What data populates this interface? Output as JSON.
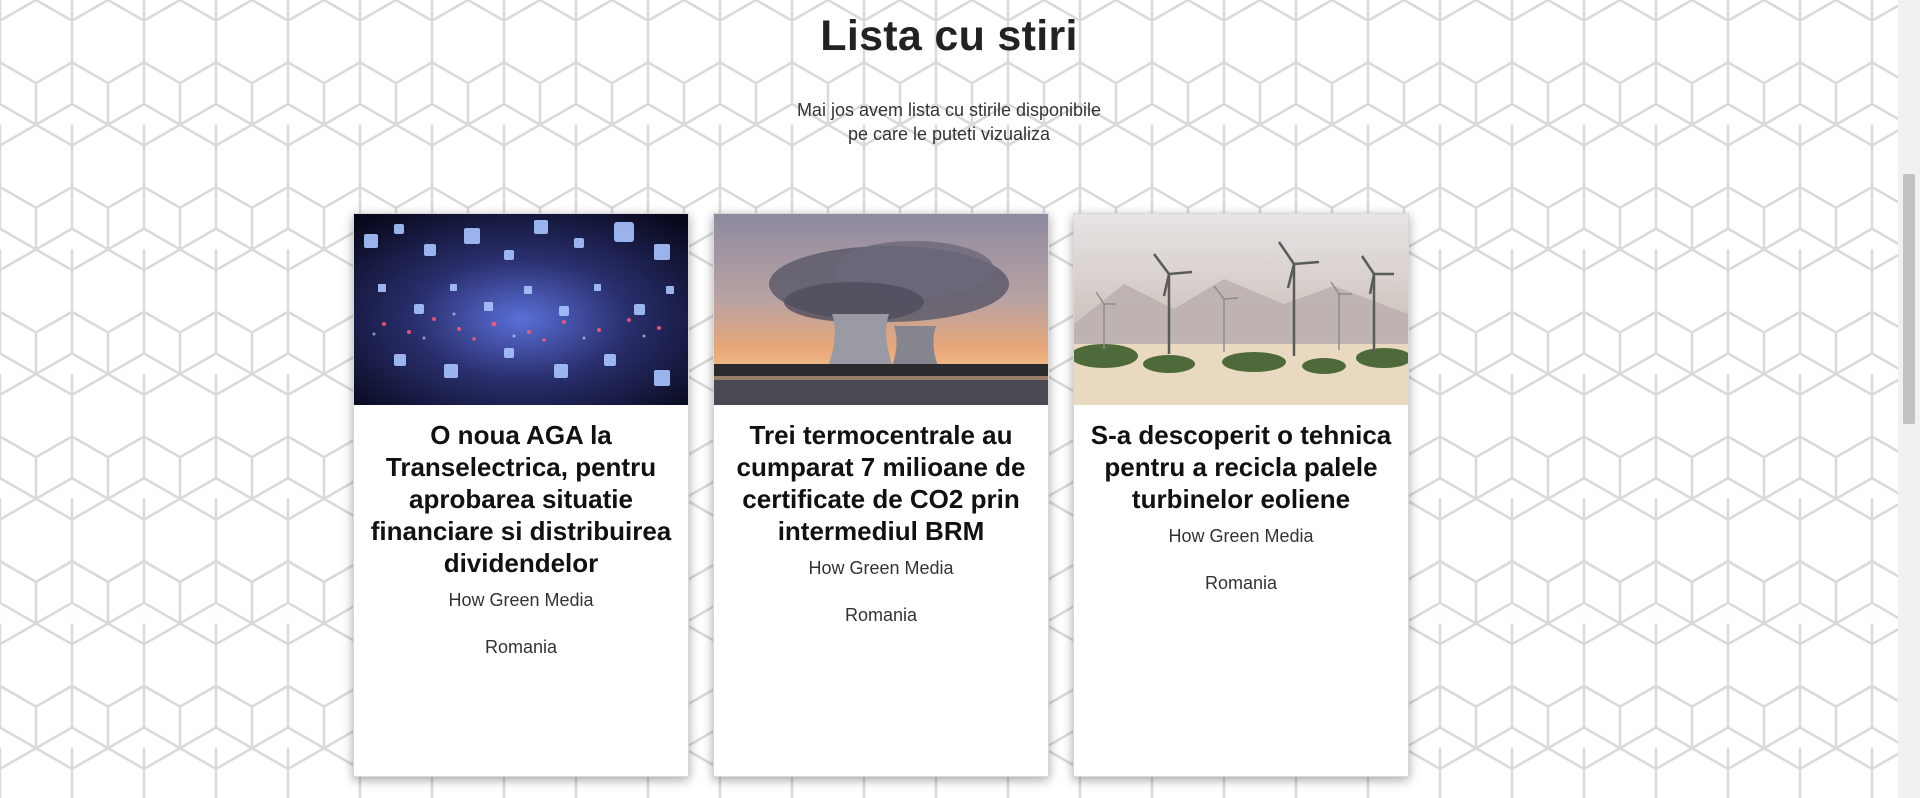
{
  "header": {
    "title": "Lista cu stiri",
    "subtitle_line1": "Mai jos avem lista cu stirile disponibile",
    "subtitle_line2": "pe care le puteti vizualiza"
  },
  "news": [
    {
      "title": "O noua AGA la Transelectrica, pentru aprobarea situatie financiare si distribuirea dividendelor",
      "source": "How Green Media",
      "country": "Romania",
      "image": "abstract-blue-lights-image"
    },
    {
      "title": "Trei termocentrale au cumparat 7 milioane de certificate de CO2 prin intermediul BRM",
      "source": "How Green Media",
      "country": "Romania",
      "image": "cooling-towers-sunset-image"
    },
    {
      "title": "S-a descoperit o tehnica pentru a recicla palele turbinelor eoliene",
      "source": "How Green Media",
      "country": "Romania",
      "image": "wind-turbines-desert-image"
    }
  ],
  "colors": {
    "background": "#ffffff",
    "hex_pattern": "#d9d9d9",
    "title": "#222222",
    "card_title": "#111111",
    "scrollbar_track": "#f1f1f1",
    "scrollbar_thumb": "#c1c1c1"
  }
}
